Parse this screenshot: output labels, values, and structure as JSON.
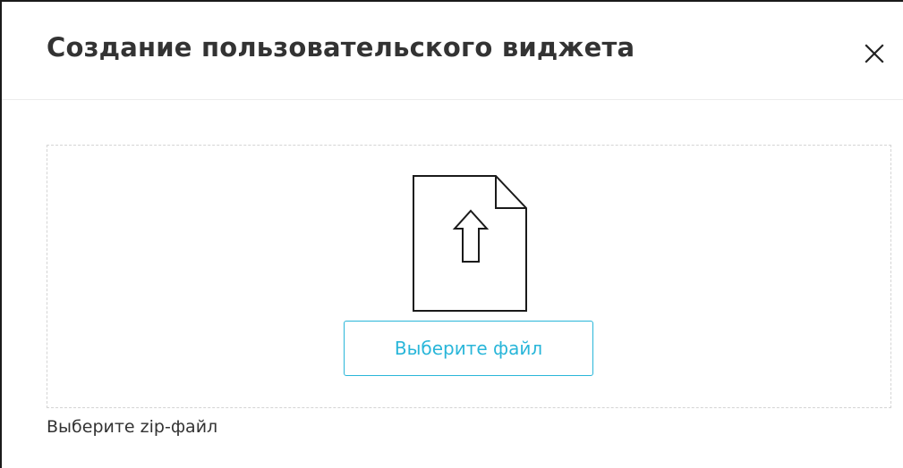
{
  "dialog": {
    "title": "Создание пользовательского виджета",
    "close_icon": "close-icon"
  },
  "dropzone": {
    "icon": "file-upload-icon",
    "button_label": "Выберите файл",
    "accent_color": "#29b6d9"
  },
  "hint": {
    "text": "Выберите zip-файл"
  }
}
